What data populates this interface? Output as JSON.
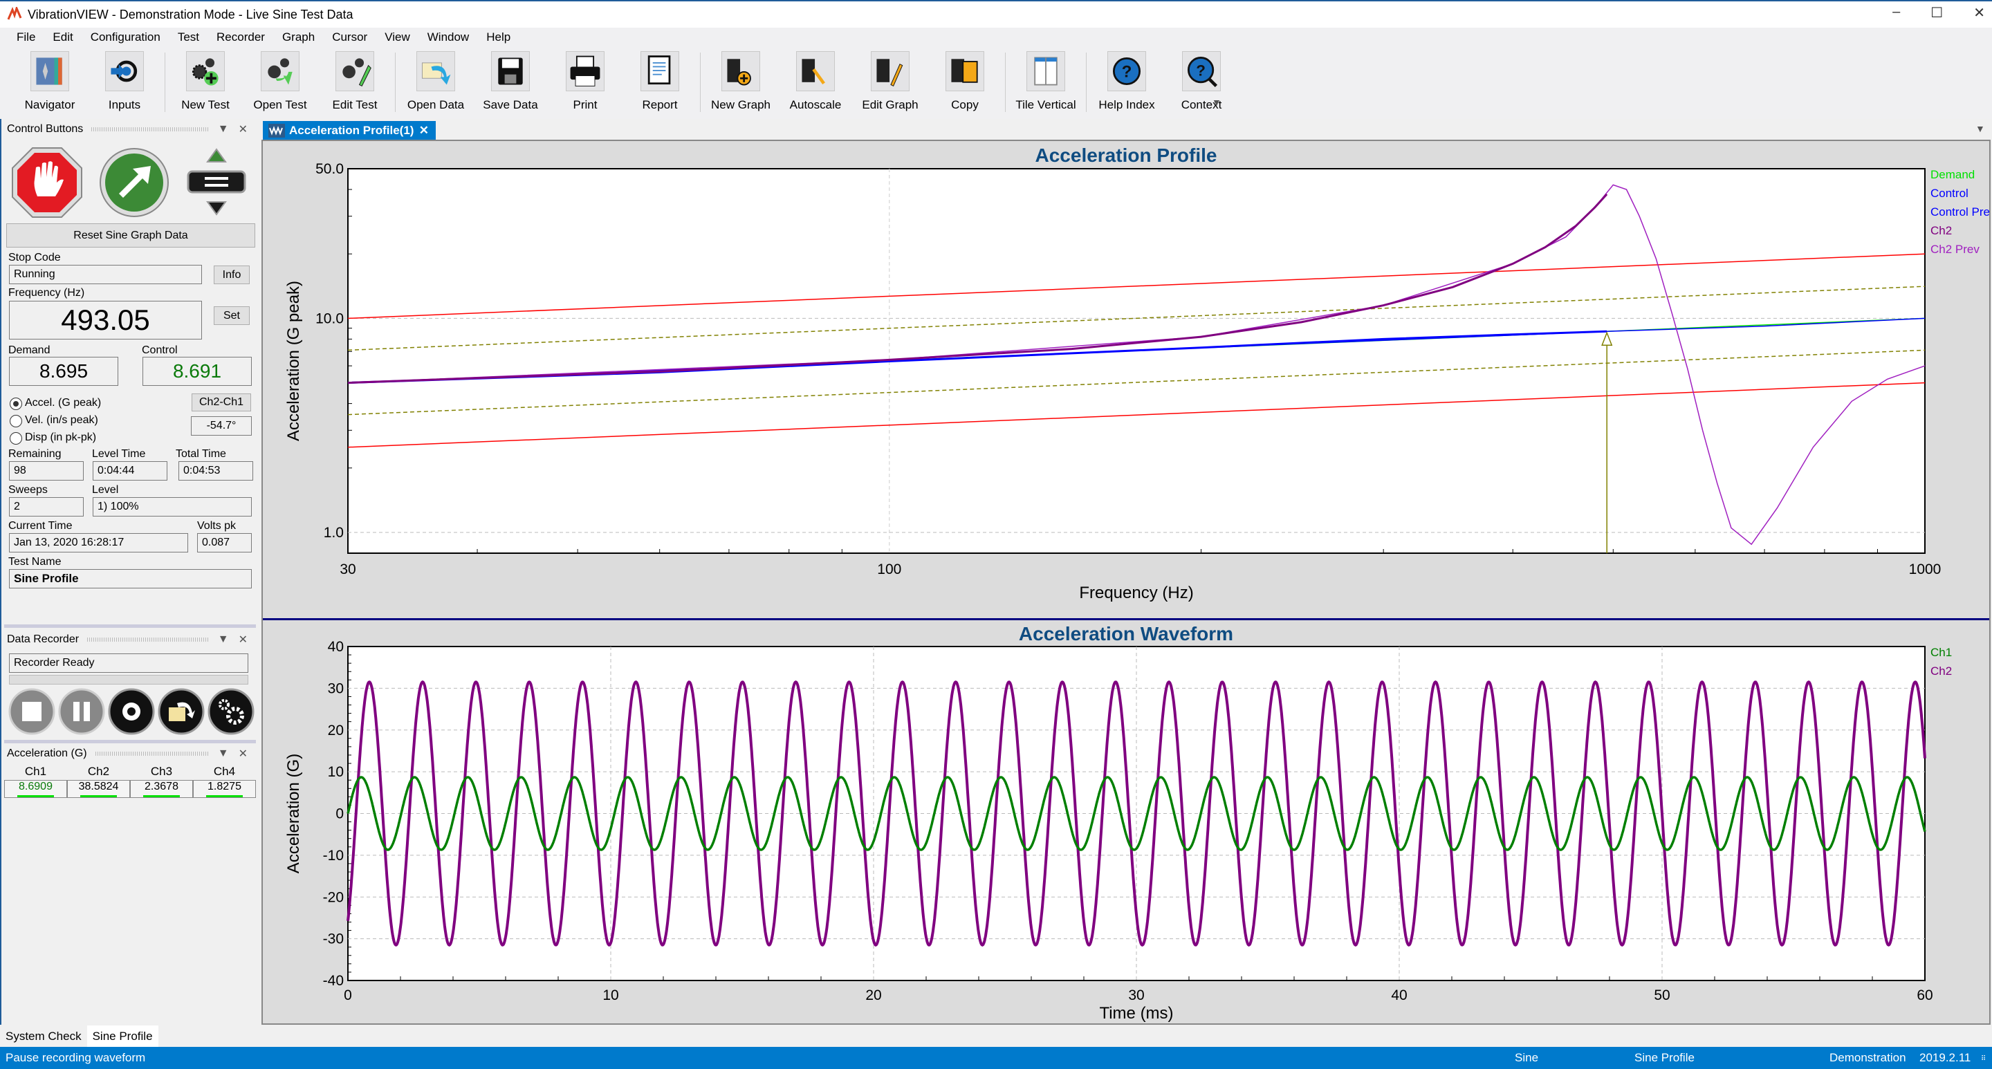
{
  "window": {
    "title": "VibrationVIEW - Demonstration Mode - Live Sine Test Data",
    "minimize": "–",
    "maximize": "☐",
    "close": "✕"
  },
  "menu": [
    "File",
    "Edit",
    "Configuration",
    "Test",
    "Recorder",
    "Graph",
    "Cursor",
    "View",
    "Window",
    "Help"
  ],
  "toolbar": [
    {
      "label": "Navigator",
      "icon": "navigator-icon"
    },
    {
      "label": "Inputs",
      "icon": "inputs-icon"
    },
    {
      "sep": true
    },
    {
      "label": "New Test",
      "icon": "new-test-icon"
    },
    {
      "label": "Open Test",
      "icon": "open-test-icon"
    },
    {
      "label": "Edit Test",
      "icon": "edit-test-icon"
    },
    {
      "sep": true
    },
    {
      "label": "Open Data",
      "icon": "open-data-icon"
    },
    {
      "label": "Save Data",
      "icon": "save-data-icon"
    },
    {
      "label": "Print",
      "icon": "print-icon"
    },
    {
      "label": "Report",
      "icon": "report-icon"
    },
    {
      "sep": true
    },
    {
      "label": "New Graph",
      "icon": "new-graph-icon"
    },
    {
      "label": "Autoscale",
      "icon": "autoscale-icon"
    },
    {
      "label": "Edit Graph",
      "icon": "edit-graph-icon"
    },
    {
      "label": "Copy",
      "icon": "copy-icon"
    },
    {
      "sep": true
    },
    {
      "label": "Tile Vertical",
      "icon": "tile-vertical-icon"
    },
    {
      "sep": true
    },
    {
      "label": "Help Index",
      "icon": "help-index-icon"
    },
    {
      "label": "Context",
      "icon": "context-help-icon"
    }
  ],
  "control_panel": {
    "title": "Control Buttons",
    "reset_label": "Reset Sine Graph Data",
    "stop_code_label": "Stop Code",
    "stop_code_value": "Running",
    "info_label": "Info",
    "frequency_label": "Frequency (Hz)",
    "frequency_value": "493.05",
    "set_label": "Set",
    "demand_label": "Demand",
    "demand_value": "8.695",
    "control_label": "Control",
    "control_value": "8.691",
    "units": [
      {
        "label": "Accel. (G peak)",
        "selected": true
      },
      {
        "label": "Vel. (in/s peak)",
        "selected": false
      },
      {
        "label": "Disp (in pk-pk)",
        "selected": false
      }
    ],
    "phase_button": "Ch2-Ch1",
    "phase_value": "-54.7°",
    "remaining_label": "Remaining",
    "remaining_value": "98",
    "level_time_label": "Level Time",
    "level_time_value": "0:04:44",
    "total_time_label": "Total Time",
    "total_time_value": "0:04:53",
    "sweeps_label": "Sweeps",
    "sweeps_value": "2",
    "level_label": "Level",
    "level_value": "1) 100%",
    "current_time_label": "Current Time",
    "current_time_value": "Jan 13, 2020 16:28:17",
    "volts_label": "Volts pk",
    "volts_value": "0.087",
    "test_name_label": "Test Name",
    "test_name_value": "Sine Profile"
  },
  "recorder_panel": {
    "title": "Data Recorder",
    "status": "Recorder Ready",
    "progress": 0
  },
  "accel_panel": {
    "title": "Acceleration (G)",
    "channels": [
      {
        "name": "Ch1",
        "value": "8.6909"
      },
      {
        "name": "Ch2",
        "value": "38.5824"
      },
      {
        "name": "Ch3",
        "value": "2.3678"
      },
      {
        "name": "Ch4",
        "value": "1.8275"
      }
    ]
  },
  "doc_tab": {
    "label": "Acceleration Profile(1)",
    "close": "✕"
  },
  "bottom_tabs": [
    {
      "label": "System Check",
      "active": false
    },
    {
      "label": "Sine Profile",
      "active": true
    }
  ],
  "status_bar": {
    "message": "Pause recording waveform",
    "mode": "Sine",
    "test": "Sine Profile",
    "license": "Demonstration",
    "version": "2019.2.11"
  },
  "chart_data": [
    {
      "type": "line",
      "title": "Acceleration Profile",
      "xlabel": "Frequency (Hz)",
      "ylabel": "Acceleration (G peak)",
      "xscale": "log",
      "yscale": "log",
      "xlim": [
        30,
        1000
      ],
      "ylim": [
        0.8,
        50
      ],
      "xticks": [
        {
          "v": 30,
          "label": "30"
        },
        {
          "v": 100,
          "label": "100"
        },
        {
          "v": 1000,
          "label": "1000"
        }
      ],
      "yticks": [
        {
          "v": 1,
          "label": "1.0"
        },
        {
          "v": 10,
          "label": "10.0"
        },
        {
          "v": 50,
          "label": "50.0"
        }
      ],
      "legend_position": "right",
      "cursor_frequency": 493.05,
      "series": [
        {
          "name": "Demand",
          "color": "#00e000",
          "legend": true,
          "x": [
            30,
            1000
          ],
          "y": [
            5.0,
            10.0
          ]
        },
        {
          "name": "Control",
          "color": "#0000ff",
          "legend": true,
          "width": 3,
          "x": [
            30,
            60,
            100,
            200,
            300,
            400,
            493
          ],
          "y": [
            5.0,
            5.6,
            6.3,
            7.3,
            8.0,
            8.4,
            8.69
          ]
        },
        {
          "name": "Control Prev",
          "color": "#0000ff",
          "legend": true,
          "width": 1.5,
          "x": [
            30,
            100,
            200,
            493,
            700,
            1000
          ],
          "y": [
            5.0,
            6.3,
            7.3,
            8.69,
            9.2,
            10.0
          ]
        },
        {
          "name": "Ch2",
          "color": "#800080",
          "legend": true,
          "width": 3,
          "x": [
            30,
            60,
            100,
            150,
            200,
            250,
            300,
            350,
            400,
            430,
            460,
            480,
            493
          ],
          "y": [
            5.0,
            5.65,
            6.4,
            7.2,
            8.2,
            9.6,
            11.5,
            14.0,
            18.0,
            21.5,
            27.0,
            33.0,
            38.0
          ]
        },
        {
          "name": "Ch2 Prev",
          "color": "#a020c0",
          "legend": true,
          "width": 1.5,
          "x": [
            30,
            100,
            200,
            300,
            400,
            450,
            480,
            500,
            515,
            530,
            550,
            570,
            590,
            610,
            630,
            650,
            680,
            720,
            780,
            850,
            920,
            1000
          ],
          "y": [
            5.0,
            6.4,
            8.2,
            11.5,
            18.0,
            24.0,
            33.0,
            42.0,
            40.0,
            30.0,
            19.0,
            10.5,
            5.8,
            3.0,
            1.7,
            1.05,
            0.88,
            1.3,
            2.5,
            4.1,
            5.2,
            6.0
          ]
        },
        {
          "name": "Abort High",
          "color": "#ff0000",
          "legend": false,
          "x": [
            30,
            1000
          ],
          "y": [
            10.0,
            20.0
          ]
        },
        {
          "name": "Alarm High",
          "color": "#808000",
          "legend": false,
          "dashed": true,
          "x": [
            30,
            1000
          ],
          "y": [
            7.1,
            14.1
          ]
        },
        {
          "name": "Alarm Low",
          "color": "#808000",
          "legend": false,
          "dashed": true,
          "x": [
            30,
            1000
          ],
          "y": [
            3.55,
            7.1
          ]
        },
        {
          "name": "Abort Low",
          "color": "#ff0000",
          "legend": false,
          "x": [
            30,
            1000
          ],
          "y": [
            2.5,
            5.0
          ]
        }
      ]
    },
    {
      "type": "line",
      "title": "Acceleration Waveform",
      "xlabel": "Time (ms)",
      "ylabel": "Acceleration (G)",
      "xlim": [
        0,
        60
      ],
      "ylim": [
        -40,
        40
      ],
      "xticks": [
        0,
        10,
        20,
        30,
        40,
        50,
        60
      ],
      "yticks": [
        -40,
        -30,
        -20,
        -10,
        0,
        10,
        20,
        30,
        40
      ],
      "grid": true,
      "legend_position": "right",
      "frequency_hz": 493.05,
      "series": [
        {
          "name": "Ch1",
          "color": "#008000",
          "amplitude": 8.69,
          "phase_deg": 0
        },
        {
          "name": "Ch2",
          "color": "#800080",
          "amplitude": 31.5,
          "phase_deg": -54.7
        }
      ]
    }
  ]
}
